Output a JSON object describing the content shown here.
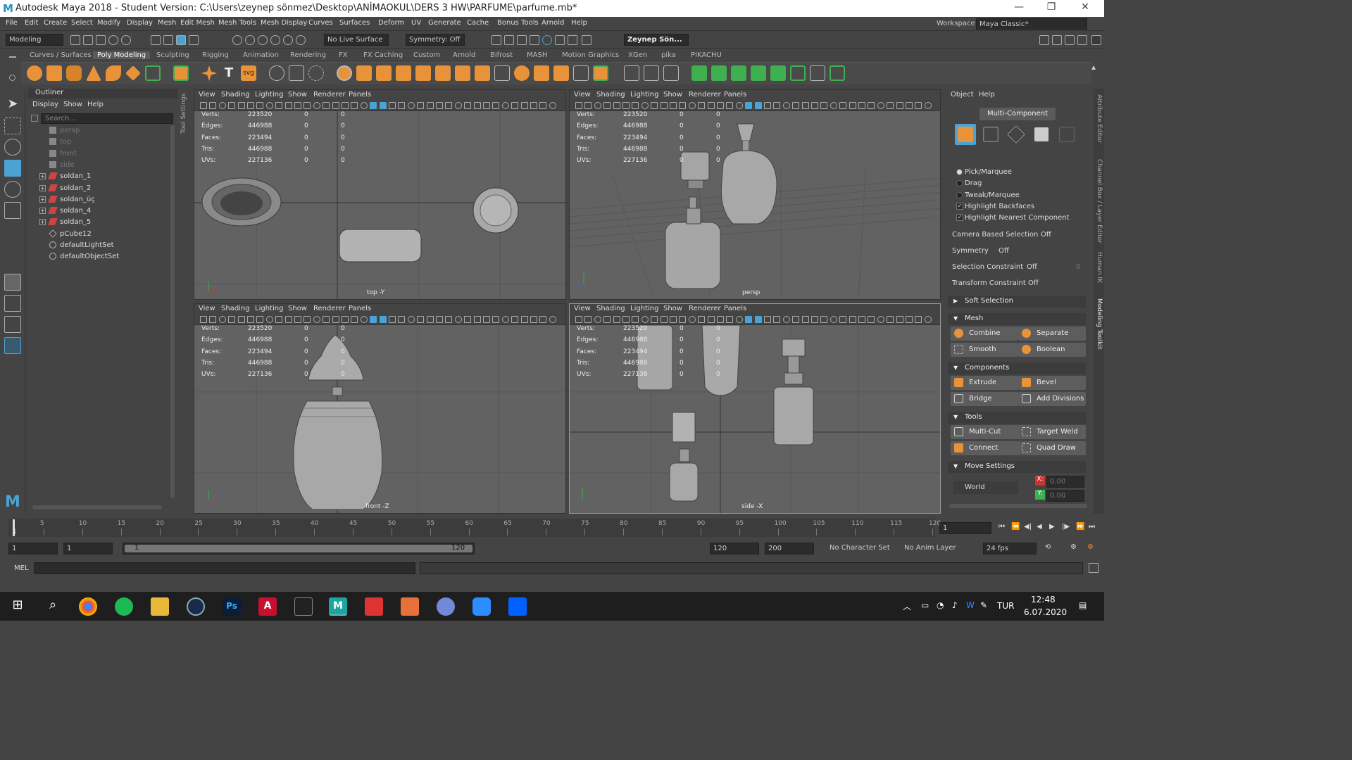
{
  "window": {
    "title": "Autodesk Maya 2018 - Student Version: C:\\Users\\zeynep sönmez\\Desktop\\ANİMAOKUL\\DERS 3 HW\\PARFUME\\parfume.mb*",
    "logo": "M"
  },
  "menus": [
    "File",
    "Edit",
    "Create",
    "Select",
    "Modify",
    "Display",
    "Mesh",
    "Edit Mesh",
    "Mesh Tools",
    "Mesh Display",
    "Curves",
    "Surfaces",
    "Deform",
    "UV",
    "Generate",
    "Cache",
    "Bonus Tools",
    "Arnold",
    "Help"
  ],
  "workspace": {
    "label": "Workspace :",
    "value": "Maya Classic*"
  },
  "status": {
    "mode": "Modeling",
    "live_surface": "No Live Surface",
    "symmetry": "Symmetry: Off",
    "user": "Zeynep Sön..."
  },
  "shelf_tabs": [
    "Curves / Surfaces",
    "Poly Modeling",
    "Sculpting",
    "Rigging",
    "Animation",
    "Rendering",
    "FX",
    "FX Caching",
    "Custom",
    "Arnold",
    "Bifrost",
    "MASH",
    "Motion Graphics",
    "XGen",
    "pika",
    "PIKACHU"
  ],
  "shelf_active": "Poly Modeling",
  "outliner": {
    "title": "Outliner",
    "menu": [
      "Display",
      "Show",
      "Help"
    ],
    "search_placeholder": "Search...",
    "items": [
      {
        "label": "persp",
        "dim": true
      },
      {
        "label": "top",
        "dim": true
      },
      {
        "label": "front",
        "dim": true
      },
      {
        "label": "side",
        "dim": true
      },
      {
        "label": "soldan_1",
        "dim": false
      },
      {
        "label": "soldan_2",
        "dim": false
      },
      {
        "label": "soldan_üç",
        "dim": false
      },
      {
        "label": "soldan_4",
        "dim": false
      },
      {
        "label": "soldan_5",
        "dim": false
      },
      {
        "label": "pCube12",
        "dim": false
      },
      {
        "label": "defaultLightSet",
        "dim": false
      },
      {
        "label": "defaultObjectSet",
        "dim": false
      }
    ]
  },
  "tool_settings_label": "Tool Settings",
  "viewport_menu": [
    "View",
    "Shading",
    "Lighting",
    "Show",
    "Renderer",
    "Panels"
  ],
  "stats": {
    "labels": [
      "Verts:",
      "Edges:",
      "Faces:",
      "Tris:",
      "UVs:"
    ],
    "values": [
      "223520",
      "446988",
      "223494",
      "446988",
      "227136"
    ],
    "zeros": "0"
  },
  "viewports": [
    "top -Y",
    "persp",
    "front -Z",
    "side -X"
  ],
  "modeling_toolkit": {
    "menu": [
      "Object",
      "Help"
    ],
    "mode_button": "Multi-Component",
    "select_options": [
      "Pick/Marquee",
      "Drag",
      "Tweak/Marquee"
    ],
    "checkboxes": [
      "Highlight Backfaces",
      "Highlight Nearest Component"
    ],
    "options": [
      {
        "label": "Camera Based Selection",
        "value": "Off"
      },
      {
        "label": "Symmetry",
        "value": "Off"
      },
      {
        "label": "Selection Constraint",
        "value": "Off",
        "extra": "0"
      },
      {
        "label": "Transform Constraint",
        "value": "Off"
      }
    ],
    "soft_selection": "Soft Selection",
    "sections": {
      "mesh": {
        "title": "Mesh",
        "buttons": [
          "Combine",
          "Separate",
          "Smooth",
          "Boolean"
        ]
      },
      "components": {
        "title": "Components",
        "buttons": [
          "Extrude",
          "Bevel",
          "Bridge",
          "Add Divisions"
        ]
      },
      "tools": {
        "title": "Tools",
        "buttons": [
          "Multi-Cut",
          "Target Weld",
          "Connect",
          "Quad Draw"
        ]
      },
      "move": {
        "title": "Move Settings",
        "space": "World",
        "x_label": "X:",
        "x": "0.00",
        "y_label": "Y:",
        "y": "0.00"
      }
    }
  },
  "right_tabs": [
    "Attribute Editor",
    "Channel Box / Layer Editor",
    "Human IK",
    "Modeling Toolkit"
  ],
  "timeline": {
    "ticks": [
      "5",
      "10",
      "15",
      "20",
      "25",
      "30",
      "35",
      "40",
      "45",
      "50",
      "55",
      "60",
      "65",
      "70",
      "75",
      "80",
      "85",
      "90",
      "95",
      "100",
      "105",
      "110",
      "115",
      "120"
    ],
    "start_marker": "1",
    "current_frame": "1"
  },
  "range": {
    "start": "1",
    "playback_start": "1",
    "slider_start": "1",
    "slider_end": "120",
    "playback_end": "120",
    "end": "200",
    "character_set": "No Character Set",
    "anim_layer": "No Anim Layer",
    "fps": "24 fps"
  },
  "command": {
    "label": "MEL"
  },
  "taskbar": {
    "lang": "TUR",
    "time": "12:48",
    "date": "6.07.2020"
  },
  "colors": {
    "accent_orange": "#e8923a",
    "active_blue": "#4ba3d4",
    "green_tool": "#3fb04f",
    "viewport_bg": "#626262"
  }
}
